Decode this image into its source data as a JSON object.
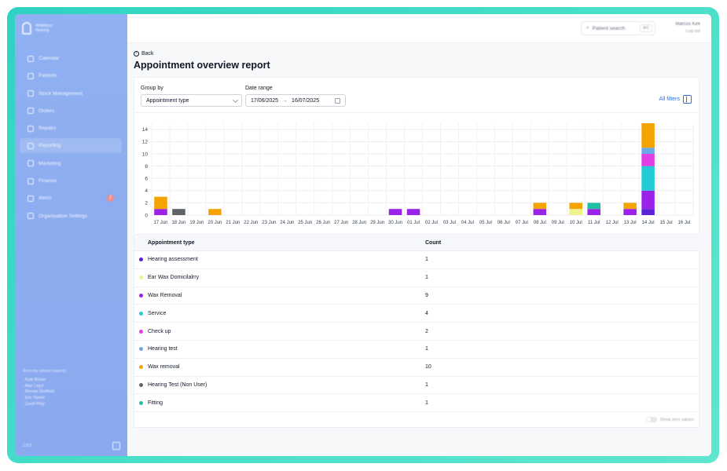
{
  "sidebar": {
    "brand": "Whiddons Hearing",
    "items": [
      {
        "label": "Calendar",
        "icon": "calendar-icon"
      },
      {
        "label": "Patients",
        "icon": "users-icon"
      },
      {
        "label": "Stock Management",
        "icon": "box-icon"
      },
      {
        "label": "Orders",
        "icon": "orders-icon"
      },
      {
        "label": "Repairs",
        "icon": "wrench-icon"
      },
      {
        "label": "Reporting",
        "icon": "chart-icon"
      },
      {
        "label": "Marketing",
        "icon": "mail-icon"
      },
      {
        "label": "Finance",
        "icon": "finance-icon"
      },
      {
        "label": "Alerts",
        "icon": "bell-icon",
        "badge": "2"
      },
      {
        "label": "Organisation Settings",
        "icon": "gear-icon"
      }
    ],
    "active_index": 5,
    "recent_title": "Recently viewed patients",
    "recent": [
      "- Kate Brown",
      "- Alan Lloyd",
      "- Brenda Sheffield",
      "- Eric Tanner",
      "- Geoff Philp"
    ],
    "footer": "1.0.0"
  },
  "topbar": {
    "search_placeholder": "Patient search",
    "search_shortcut": "⌘K",
    "user_name": "Marcus Kirk",
    "logout": "Log out"
  },
  "page": {
    "back_label": "Back",
    "title": "Appointment overview report"
  },
  "filters": {
    "group_by_label": "Group by",
    "group_by_value": "Appointment type",
    "date_range_label": "Date range",
    "date_from": "17/06/2025",
    "date_to": "16/07/2025",
    "all_filters": "All filters"
  },
  "chart_data": {
    "type": "bar",
    "stacked": true,
    "categories": [
      "17 Jun",
      "18 Jun",
      "19 Jun",
      "20 Jun",
      "21 Jun",
      "22 Jun",
      "23 Jun",
      "24 Jun",
      "25 Jun",
      "26 Jun",
      "27 Jun",
      "28 Jun",
      "29 Jun",
      "30 Jun",
      "01 Jul",
      "02 Jul",
      "03 Jul",
      "04 Jul",
      "05 Jul",
      "06 Jul",
      "07 Jul",
      "08 Jul",
      "09 Jul",
      "10 Jul",
      "11 Jul",
      "12 Jul",
      "13 Jul",
      "14 Jul",
      "15 Jul",
      "16 Jul"
    ],
    "ylim": [
      0,
      15
    ],
    "yticks": [
      0,
      2,
      4,
      6,
      8,
      10,
      12,
      14
    ],
    "grid": true,
    "series": [
      {
        "name": "Hearing assessment",
        "color": "#5b21d6",
        "values": [
          0,
          0,
          0,
          0,
          0,
          0,
          0,
          0,
          0,
          0,
          0,
          0,
          0,
          0,
          0,
          0,
          0,
          0,
          0,
          0,
          0,
          0,
          0,
          0,
          0,
          0,
          0,
          1,
          0,
          0
        ]
      },
      {
        "name": "Wax Removal",
        "color": "#9b22e8",
        "values": [
          1,
          0,
          0,
          0,
          0,
          0,
          0,
          0,
          0,
          0,
          0,
          0,
          0,
          1,
          1,
          0,
          0,
          0,
          0,
          0,
          0,
          1,
          0,
          0,
          1,
          0,
          1,
          3,
          0,
          0
        ]
      },
      {
        "name": "Ear Wax Domiciliary",
        "color": "#f0f28c",
        "values": [
          0,
          0,
          0,
          0,
          0,
          0,
          0,
          0,
          0,
          0,
          0,
          0,
          0,
          0,
          0,
          0,
          0,
          0,
          0,
          0,
          0,
          0,
          0,
          1,
          0,
          0,
          0,
          0,
          0,
          0
        ]
      },
      {
        "name": "Fitting",
        "color": "#1fbfa3",
        "values": [
          0,
          0,
          0,
          0,
          0,
          0,
          0,
          0,
          0,
          0,
          0,
          0,
          0,
          0,
          0,
          0,
          0,
          0,
          0,
          0,
          0,
          0,
          0,
          0,
          1,
          0,
          0,
          0,
          0,
          0
        ]
      },
      {
        "name": "Service",
        "color": "#22ccd6",
        "values": [
          0,
          0,
          0,
          0,
          0,
          0,
          0,
          0,
          0,
          0,
          0,
          0,
          0,
          0,
          0,
          0,
          0,
          0,
          0,
          0,
          0,
          0,
          0,
          0,
          0,
          0,
          0,
          4,
          0,
          0
        ]
      },
      {
        "name": "Check up",
        "color": "#e23ee6",
        "values": [
          0,
          0,
          0,
          0,
          0,
          0,
          0,
          0,
          0,
          0,
          0,
          0,
          0,
          0,
          0,
          0,
          0,
          0,
          0,
          0,
          0,
          0,
          0,
          0,
          0,
          0,
          0,
          2,
          0,
          0
        ]
      },
      {
        "name": "Hearing test",
        "color": "#6aa8e6",
        "values": [
          0,
          0,
          0,
          0,
          0,
          0,
          0,
          0,
          0,
          0,
          0,
          0,
          0,
          0,
          0,
          0,
          0,
          0,
          0,
          0,
          0,
          0,
          0,
          0,
          0,
          0,
          0,
          1,
          0,
          0
        ]
      },
      {
        "name": "Hearing Test (Non User)",
        "color": "#5f6368",
        "values": [
          0,
          1,
          0,
          0,
          0,
          0,
          0,
          0,
          0,
          0,
          0,
          0,
          0,
          0,
          0,
          0,
          0,
          0,
          0,
          0,
          0,
          0,
          0,
          0,
          0,
          0,
          0,
          0,
          0,
          0
        ]
      },
      {
        "name": "Wax removal",
        "color": "#f5a300",
        "values": [
          2,
          0,
          0,
          1,
          0,
          0,
          0,
          0,
          0,
          0,
          0,
          0,
          0,
          0,
          0,
          0,
          0,
          0,
          0,
          0,
          0,
          1,
          0,
          1,
          0,
          0,
          1,
          4,
          0,
          0
        ]
      }
    ]
  },
  "table": {
    "headers": [
      "Appointment type",
      "Count"
    ],
    "rows": [
      {
        "label": "Hearing assessment",
        "count": "1",
        "color": "#5b21d6"
      },
      {
        "label": "Ear Wax Domicilalrry",
        "count": "1",
        "color": "#f0f28c"
      },
      {
        "label": "Wax Removal",
        "count": "9",
        "color": "#9b22e8"
      },
      {
        "label": "Service",
        "count": "4",
        "color": "#22ccd6"
      },
      {
        "label": "Check up",
        "count": "2",
        "color": "#e23ee6"
      },
      {
        "label": "Hearing test",
        "count": "1",
        "color": "#6aa8e6"
      },
      {
        "label": "Wax removal",
        "count": "10",
        "color": "#f5a300"
      },
      {
        "label": "Hearing Test (Non User)",
        "count": "1",
        "color": "#5f6368"
      },
      {
        "label": "Fitting",
        "count": "1",
        "color": "#1fbfa3"
      }
    ]
  },
  "footer": {
    "zero_values_label": "Show zero values"
  }
}
